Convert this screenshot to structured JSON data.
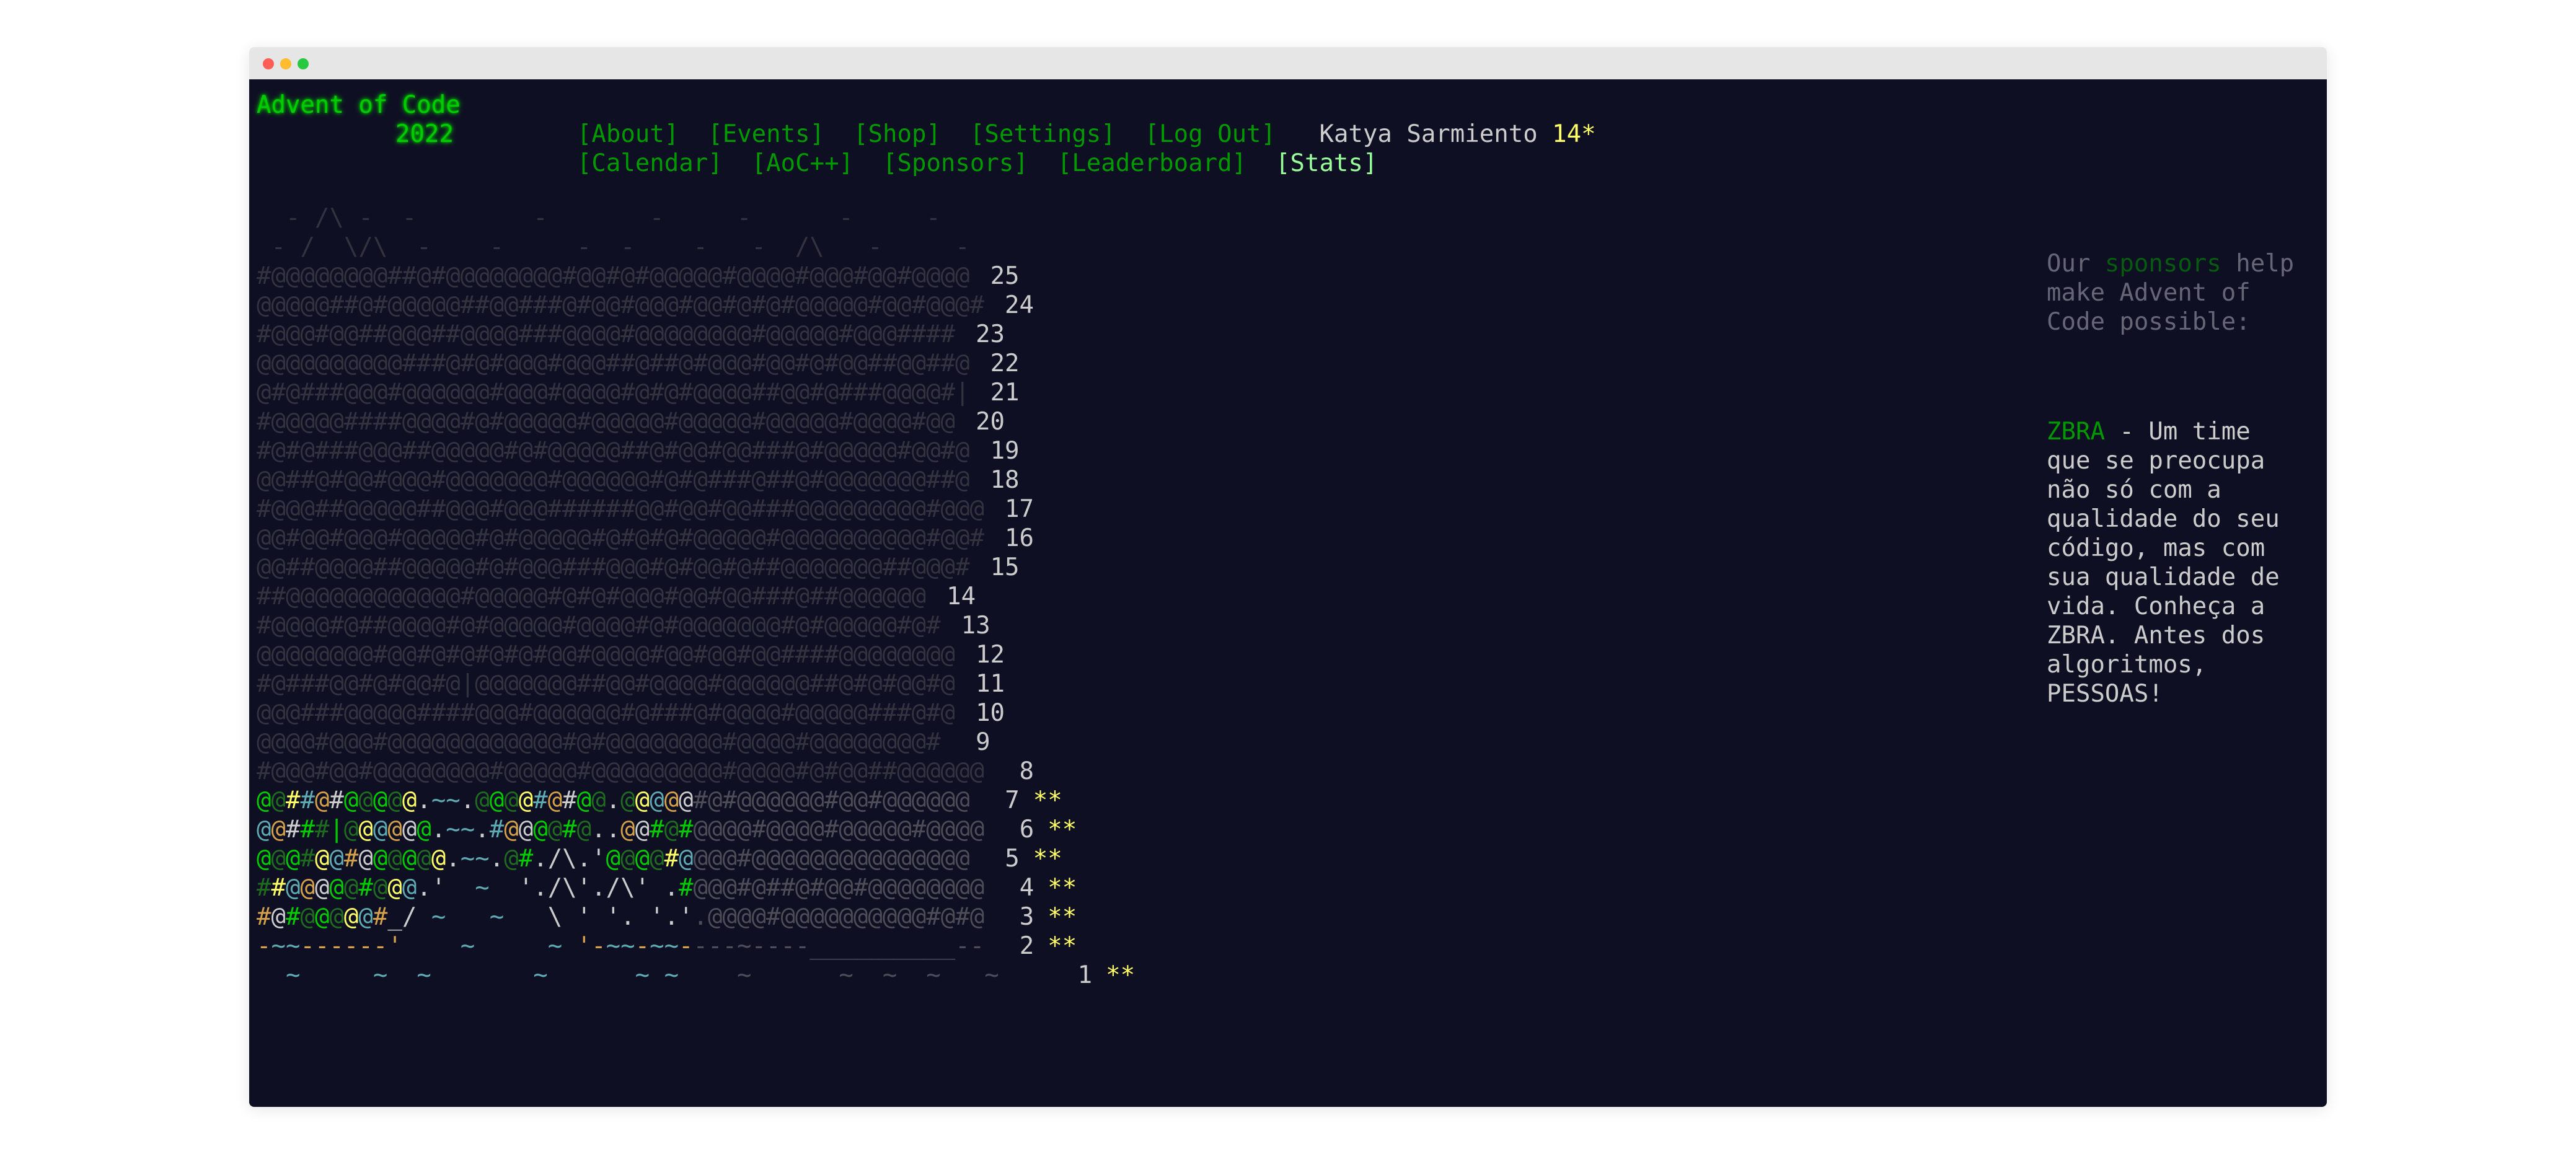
{
  "window": {
    "controls": [
      "close",
      "minimize",
      "zoom"
    ]
  },
  "header": {
    "brand_title": "Advent of Code",
    "brand_year": "2022",
    "nav_row1": [
      "[About]",
      "[Events]",
      "[Shop]",
      "[Settings]",
      "[Log Out]"
    ],
    "nav_row2": [
      "[Calendar]",
      "[AoC++]",
      "[Sponsors]",
      "[Leaderboard]",
      "[Stats]"
    ],
    "active_nav": "[Stats]",
    "user_name": "Katya Sarmiento",
    "star_count": "14*"
  },
  "calendar": {
    "header_lines": [
      "  - /\\ -  -        -       -     -      -     -   ",
      " - /  \\/\\  -    -     -  -    -   -  /\\   -     -"
    ],
    "rows": [
      {
        "art": "#@@@@@@@@##@#@@@@@@@@#@@#@#@@@@@#@@@@#@@@#@@#@@@@",
        "day": "25",
        "stars": ""
      },
      {
        "art": "@@@@@##@#@@@@@##@@###@#@@#@@@#@@#@#@#@@@@@#@@#@@@#",
        "day": "24",
        "stars": ""
      },
      {
        "art": "#@@@#@@##@@@##@@@@###@@@@#@@@@@@@@#@@@@@#@@@####",
        "day": "23",
        "stars": ""
      },
      {
        "art": "@@@@@@@@@@###@#@#@@@#@@@##@##@#@@@#@@#@#@@##@@##@",
        "day": "22",
        "stars": ""
      },
      {
        "art": "@#@###@@@#@@@@@@#@@@#@@@@#@#@#@@@@##@@#@###@@@@#|",
        "day": "21",
        "stars": ""
      },
      {
        "art": "#@@@@@####@@@@#@#@@@@@#@@@@@#@@@@@#@@@@@#@@@@#@@",
        "day": "20",
        "stars": ""
      },
      {
        "art": "#@#@###@@@##@@@@@#@#@@@@@##@#@@#@@###@#@@@@@#@@#@",
        "day": "19",
        "stars": ""
      },
      {
        "art": "@@##@#@@#@@@#@@@@@@@#@@@@@@#@#@###@##@#@@@@@@@##@",
        "day": "18",
        "stars": ""
      },
      {
        "art": "#@@@##@@@@@##@@@#@@@######@@#@@#@@###@@@@@@@@@#@@@",
        "day": "17",
        "stars": ""
      },
      {
        "art": "@@#@@#@@@#@@@@@#@#@@@@@#@#@#@#@@@@@#@@@@@@@@@@#@@#",
        "day": "16",
        "stars": ""
      },
      {
        "art": "@@##@@@@##@@@@@#@#@@@###@@@#@#@@#@##@@@@@@@##@@@#",
        "day": "15",
        "stars": ""
      },
      {
        "art": "##@@@@@@@@@@@@#@@@@@#@#@#@@@#@@#@@###@##@@@@@@",
        "day": "14",
        "stars": ""
      },
      {
        "art": "#@@@@#@##@@@@#@#@@@@@#@@@@#@#@@@@@@@#@#@@@@@#@#",
        "day": "13",
        "stars": ""
      },
      {
        "art": "@@@@@@@@#@@#@#@#@#@#@@#@@@@#@@#@@#@@####@@@@@@@@",
        "day": "12",
        "stars": ""
      },
      {
        "art": "#@###@@#@#@@#@|@@@@@@@##@@#@@@@#@@@@@@##@#@#@@#@",
        "day": "11",
        "stars": ""
      },
      {
        "art": "@@@###@@@@@####@@@#@@@@@@#@###@#@@@@#@@@@@###@#@",
        "day": "10",
        "stars": ""
      },
      {
        "art": "@@@@#@@@#@@@@@@@@@@@@#@#@@@@@@@@#@@@@#@@@@@@@@#",
        "day": "9",
        "stars": ""
      },
      {
        "art": "#@@@#@@#@@@@@@@@#@@@@@#@@@@@@@@@#@@@@#@#@@##@@@@@@",
        "day": "8",
        "stars": ""
      },
      {
        "art": "@@##@#@@@@@.~~.@@@@#@#@@.@@@@@#@#@@@@@@#@@#@@@@@@",
        "day": "7",
        "stars": "**"
      },
      {
        "art": "@@###|@@@@@@.~~.#@@@@#@..@@#@#@@@@#@@@@#@@@@@#@@@@",
        "day": "6",
        "stars": "**"
      },
      {
        "art": "@@@#@@#@@@@@@.~~.@#./\\.'@@@@#@@@@#@@@@@@@@@@@@@@@",
        "day": "5",
        "stars": "**"
      },
      {
        "art": "##@@@@@#@@@.'  ~  './\\'./\\' .#@@@#@##@#@@#@@@@@@@@",
        "day": "4",
        "stars": "**"
      },
      {
        "art": "#@#@@@@@#_/ ~   ~   \\ ' '. '.'.@@@@#@@@@@@@@@@#@#@",
        "day": "3",
        "stars": "**"
      },
      {
        "art": "-~~------'    ~     ~ '-~~-~~----~----__________--",
        "day": "2",
        "stars": "**"
      },
      {
        "art": "  ~     ~  ~       ~      ~ ~    ~      ~  ~  ~   ~   ",
        "day": "1",
        "stars": "**"
      }
    ]
  },
  "sidebar": {
    "intro_before": "Our ",
    "intro_link": "sponsors",
    "intro_after_lines": [
      " help",
      "make Advent of",
      "Code possible:"
    ],
    "sponsor_name": "ZBRA",
    "sponsor_text_lines": [
      " - Um time",
      "que se preocupa",
      "não só com a",
      "qualidade do seu",
      "código, mas com",
      "sua qualidade de",
      "vida. Conheça a",
      "ZBRA. Antes dos",
      "algoritmos,",
      "PESSOAS!"
    ]
  },
  "colors": {
    "background": "#0f0f23",
    "brand_green": "#00cc00",
    "nav_green": "#009900",
    "star_yellow": "#ffff66",
    "text": "#cccccc"
  }
}
